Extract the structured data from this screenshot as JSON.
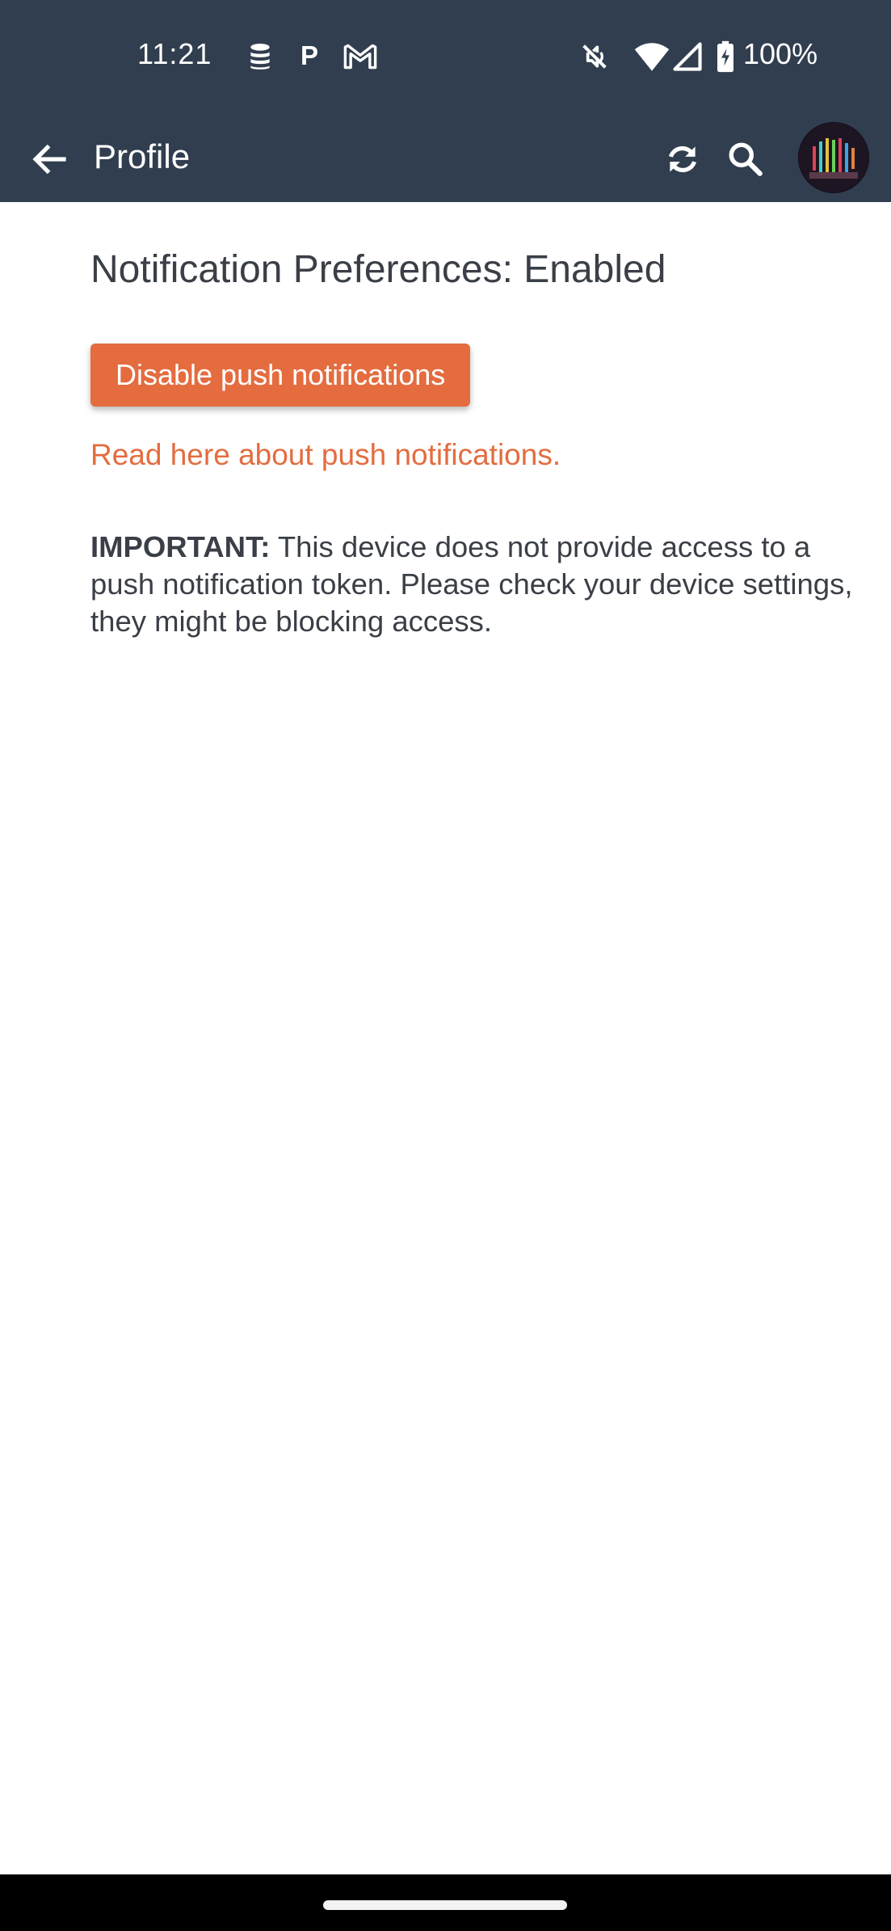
{
  "status_bar": {
    "time": "11:21",
    "letter_icon": "P",
    "battery_text": "100%",
    "icons": [
      "database-icon",
      "p-icon",
      "gmail-icon",
      "mute-icon",
      "wifi-icon",
      "signal-icon",
      "battery-charging-icon"
    ]
  },
  "app_bar": {
    "title": "Profile",
    "icons": [
      "back-arrow-icon",
      "refresh-icon",
      "search-icon",
      "avatar"
    ]
  },
  "content": {
    "heading": "Notification Preferences: Enabled",
    "disable_button_label": "Disable push notifications",
    "read_link": "Read here about push notifications.",
    "important_label": "IMPORTANT:",
    "important_body": " This device does not provide access to a push notification token. Please check your device settings, they might be blocking access."
  },
  "colors": {
    "header_bg": "#313e4f",
    "accent": "#e46c3f",
    "text": "#3a3f47"
  }
}
